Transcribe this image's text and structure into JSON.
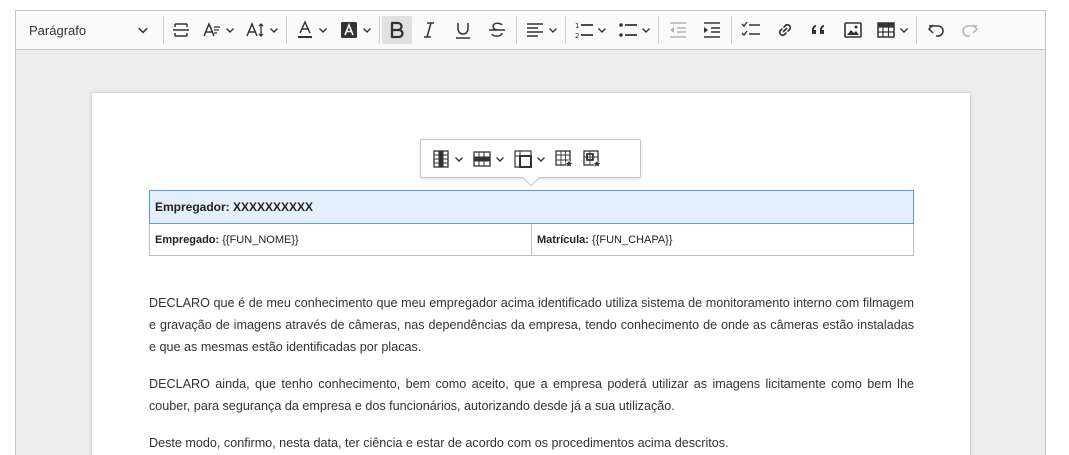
{
  "toolbar": {
    "heading_label": "Parágrafo",
    "buttons": [
      {
        "name": "horizontal-line-icon",
        "tooltip": "Linha horizontal"
      },
      {
        "name": "font-family-icon",
        "tooltip": "Fonte"
      },
      {
        "name": "font-size-icon",
        "tooltip": "Tamanho da fonte"
      },
      {
        "name": "font-color-icon",
        "tooltip": "Cor da fonte"
      },
      {
        "name": "font-background-color-icon",
        "tooltip": "Cor de fundo"
      },
      {
        "name": "bold-icon",
        "tooltip": "Negrito",
        "active": true
      },
      {
        "name": "italic-icon",
        "tooltip": "Itálico"
      },
      {
        "name": "underline-icon",
        "tooltip": "Sublinhado"
      },
      {
        "name": "strikethrough-icon",
        "tooltip": "Tachado"
      },
      {
        "name": "align-icon",
        "tooltip": "Alinhamento"
      },
      {
        "name": "numbered-list-icon",
        "tooltip": "Lista numerada"
      },
      {
        "name": "bulleted-list-icon",
        "tooltip": "Lista com marcadores"
      },
      {
        "name": "outdent-icon",
        "tooltip": "Diminuir recuo",
        "disabled": true
      },
      {
        "name": "indent-icon",
        "tooltip": "Aumentar recuo"
      },
      {
        "name": "todo-list-icon",
        "tooltip": "Lista de tarefas"
      },
      {
        "name": "link-icon",
        "tooltip": "Link"
      },
      {
        "name": "blockquote-icon",
        "tooltip": "Citação"
      },
      {
        "name": "image-icon",
        "tooltip": "Imagem"
      },
      {
        "name": "table-icon",
        "tooltip": "Tabela"
      },
      {
        "name": "undo-icon",
        "tooltip": "Desfazer"
      },
      {
        "name": "redo-icon",
        "tooltip": "Refazer",
        "disabled": true
      }
    ]
  },
  "table_toolbar": {
    "buttons": [
      {
        "name": "table-column-icon"
      },
      {
        "name": "table-row-icon"
      },
      {
        "name": "merge-cells-icon"
      },
      {
        "name": "table-properties-icon"
      },
      {
        "name": "cell-properties-icon"
      }
    ]
  },
  "document": {
    "table": {
      "row1": "Empregador: XXXXXXXXXX",
      "row2_left_label": "Empregado:",
      "row2_left_value": " {{FUN_NOME}}",
      "row2_right_label": "Matrícula:",
      "row2_right_value": " {{FUN_CHAPA}}"
    },
    "paragraphs": [
      "DECLARO que é de meu conhecimento que meu empregador acima identificado utiliza sistema de monitoramento interno com filmagem e gravação de imagens através de câmeras, nas dependências da empresa, tendo conhecimento de onde as câmeras estão instaladas e que as mesmas estão identificadas por placas.",
      "DECLARO ainda, que tenho conhecimento, bem como aceito, que a empresa poderá utilizar as imagens licitamente como bem lhe couber, para segurança da empresa e dos funcionários, autorizando desde já a sua utilização.",
      "Deste modo, confirmo, nesta data, ter ciência e estar de acordo com os procedimentos acima descritos."
    ]
  },
  "colors": {
    "selected_cell_bg": "#e3effb",
    "selected_cell_border": "#5b9bd5",
    "toolbar_bg": "#fafafa",
    "editor_bg": "#ededed"
  }
}
